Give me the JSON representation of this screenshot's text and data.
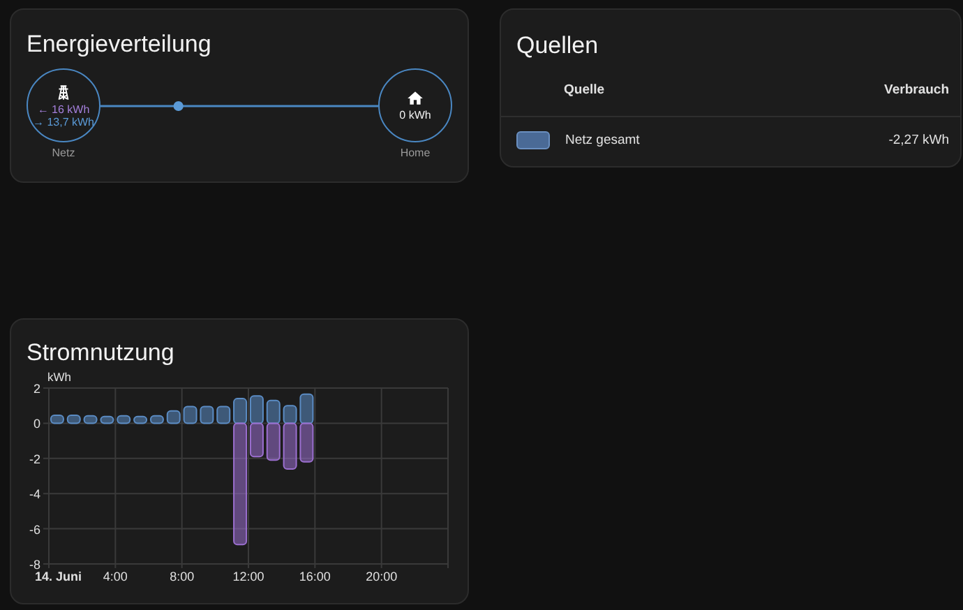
{
  "energy_distribution": {
    "title": "Energieverteilung",
    "grid": {
      "label": "Netz",
      "consumed": "← 16 kWh",
      "returned": "→ 13,7 kWh"
    },
    "home": {
      "label": "Home",
      "value": "0 kWh"
    }
  },
  "sources": {
    "title": "Quellen",
    "columns": [
      "Quelle",
      "Verbrauch"
    ],
    "rows": [
      {
        "color": "#4a6a96",
        "name": "Netz gesamt",
        "value": "-2,27 kWh"
      }
    ]
  },
  "usage": {
    "title": "Stromnutzung",
    "chart_data": {
      "type": "bar",
      "stacked": true,
      "grid": true,
      "ylabel": "kWh",
      "x": [
        0.5,
        1.5,
        2.5,
        3.5,
        4.5,
        5.5,
        6.5,
        7.5,
        8.5,
        9.5,
        10.5,
        11.5,
        12.5,
        13.5,
        14.5,
        15.5
      ],
      "xlim": [
        0,
        24
      ],
      "ylim": [
        -8,
        2
      ],
      "yticks": [
        2,
        0,
        -2,
        -4,
        -6,
        -8
      ],
      "xticks": [
        {
          "value": 0,
          "label": "14. Juni"
        },
        {
          "value": 4,
          "label": "4:00"
        },
        {
          "value": 8,
          "label": "8:00"
        },
        {
          "value": 12,
          "label": "12:00"
        },
        {
          "value": 16,
          "label": "16:00"
        },
        {
          "value": 20,
          "label": "20:00"
        }
      ],
      "series": [
        {
          "color": "#5b8cc4",
          "values": [
            0.45,
            0.45,
            0.42,
            0.38,
            0.42,
            0.38,
            0.42,
            0.7,
            0.95,
            0.95,
            0.95,
            1.4,
            1.55,
            1.3,
            1.0,
            1.65
          ]
        },
        {
          "color": "#9b6fcf",
          "values": [
            null,
            null,
            null,
            null,
            null,
            null,
            null,
            null,
            null,
            null,
            null,
            -6.9,
            -1.9,
            -2.1,
            -2.6,
            -2.2
          ]
        }
      ]
    }
  }
}
